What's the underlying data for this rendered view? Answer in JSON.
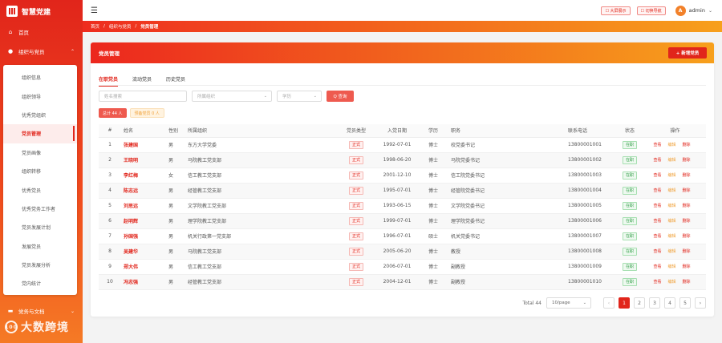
{
  "app": {
    "title": "智慧党建"
  },
  "sidebar": {
    "home": "首页",
    "group": "组织与党员",
    "items": [
      {
        "label": "组织信息"
      },
      {
        "label": "组织领导"
      },
      {
        "label": "优秀党组织"
      },
      {
        "label": "党员管理"
      },
      {
        "label": "党员画像"
      },
      {
        "label": "组织转移"
      },
      {
        "label": "优秀党员"
      },
      {
        "label": "优秀党务工作者"
      },
      {
        "label": "党员发展计划"
      },
      {
        "label": "发展党员"
      },
      {
        "label": "党员发展分析"
      },
      {
        "label": "党内统计"
      }
    ],
    "bottom_item": "党务与文档"
  },
  "watermark": {
    "text": "大数跨境",
    "badge": "100"
  },
  "topbar": {
    "btn1": "☐ 大屏展示",
    "btn2": "☐ 切换导航",
    "user": "admin",
    "avatar_letter": "A"
  },
  "breadcrumb": [
    "首页",
    "组织与党员",
    "党员管理"
  ],
  "card": {
    "title": "党员管理",
    "add_button": "+ 新增党员"
  },
  "tabs": [
    "在职党员",
    "流动党员",
    "历史党员"
  ],
  "filters": {
    "search_placeholder": "姓名搜索",
    "org_placeholder": "所属组织",
    "edu_placeholder": "学历",
    "query_button": "Q 查询"
  },
  "summary": {
    "total_badge": "总计 44 人",
    "probation_badge": "预备党员 0 人"
  },
  "table": {
    "headers": [
      "#",
      "姓名",
      "性别",
      "所属组织",
      "党员类型",
      "入党日期",
      "学历",
      "职务",
      "联系电话",
      "状态",
      "操作"
    ],
    "rows": [
      {
        "no": "1",
        "name": "张建国",
        "gender": "男",
        "org": "东方大学党委",
        "type": "正式",
        "date": "1992-07-01",
        "edu": "博士",
        "title": "校党委书记",
        "phone": "13800001001",
        "status": "在职"
      },
      {
        "no": "2",
        "name": "王晓明",
        "gender": "男",
        "org": "马院教工党支部",
        "type": "正式",
        "date": "1998-06-20",
        "edu": "博士",
        "title": "马院党委书记",
        "phone": "13800001002",
        "status": "在职"
      },
      {
        "no": "3",
        "name": "李红梅",
        "gender": "女",
        "org": "信工教工党支部",
        "type": "正式",
        "date": "2001-12-10",
        "edu": "博士",
        "title": "信工院党委书记",
        "phone": "13800001003",
        "status": "在职"
      },
      {
        "no": "4",
        "name": "陈志远",
        "gender": "男",
        "org": "经管教工党支部",
        "type": "正式",
        "date": "1995-07-01",
        "edu": "博士",
        "title": "经管院党委书记",
        "phone": "13800001004",
        "status": "在职"
      },
      {
        "no": "5",
        "name": "刘思远",
        "gender": "男",
        "org": "文学院教工党支部",
        "type": "正式",
        "date": "1993-06-15",
        "edu": "博士",
        "title": "文学院党委书记",
        "phone": "13800001005",
        "status": "在职"
      },
      {
        "no": "6",
        "name": "赵明辉",
        "gender": "男",
        "org": "理学院教工党支部",
        "type": "正式",
        "date": "1999-07-01",
        "edu": "博士",
        "title": "理学院党委书记",
        "phone": "13800001006",
        "status": "在职"
      },
      {
        "no": "7",
        "name": "孙国强",
        "gender": "男",
        "org": "机关行政第一党支部",
        "type": "正式",
        "date": "1996-07-01",
        "edu": "硕士",
        "title": "机关党委书记",
        "phone": "13800001007",
        "status": "在职"
      },
      {
        "no": "8",
        "name": "吴建华",
        "gender": "男",
        "org": "马院教工党支部",
        "type": "正式",
        "date": "2005-06-20",
        "edu": "博士",
        "title": "教授",
        "phone": "13800001008",
        "status": "在职"
      },
      {
        "no": "9",
        "name": "郑大伟",
        "gender": "男",
        "org": "信工教工党支部",
        "type": "正式",
        "date": "2006-07-01",
        "edu": "博士",
        "title": "副教授",
        "phone": "13800001009",
        "status": "在职"
      },
      {
        "no": "10",
        "name": "冯志强",
        "gender": "男",
        "org": "经管教工党支部",
        "type": "正式",
        "date": "2004-12-01",
        "edu": "博士",
        "title": "副教授",
        "phone": "13800001010",
        "status": "在职"
      }
    ],
    "actions": {
      "view": "查看",
      "edit": "编辑",
      "delete": "删除"
    }
  },
  "pagination": {
    "total": "Total 44",
    "page_size": "10/page",
    "pages": [
      "1",
      "2",
      "3",
      "4",
      "5"
    ],
    "prev": "‹",
    "next": "›"
  }
}
